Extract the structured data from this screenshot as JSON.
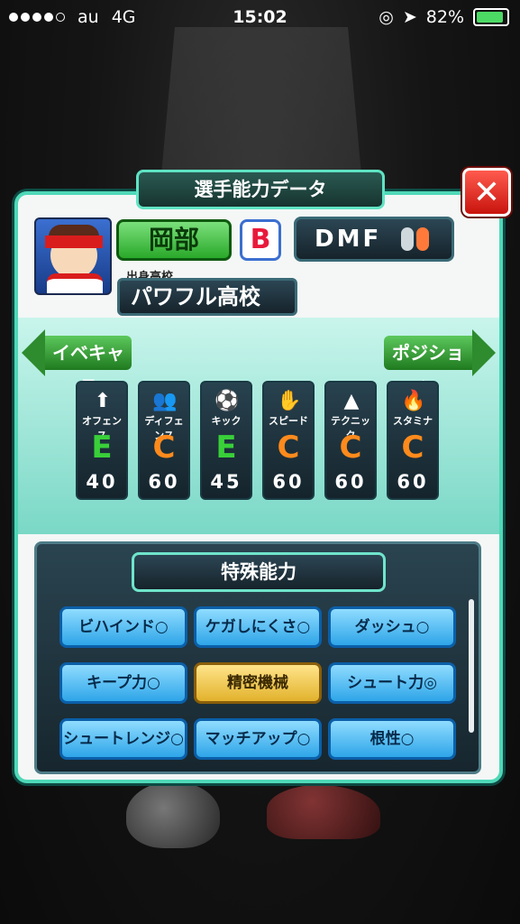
{
  "status_bar": {
    "carrier": "au",
    "network": "4G",
    "time": "15:02",
    "battery": "82%",
    "battery_color": "#4cd964"
  },
  "panel": {
    "title": "選手能力データ",
    "close_icon": "close-icon",
    "close_glyph": "✕",
    "accent": "#4fd8b8"
  },
  "player": {
    "name": "岡部",
    "rank": "B",
    "rank_color": "#e81a3c",
    "position": "DMF",
    "school_label": "出身高校",
    "school": "パワフル高校"
  },
  "nav": {
    "left_label": "イベキャラ",
    "right_label": "ポジション"
  },
  "stats": [
    {
      "label": "オフェンス",
      "grade": "E",
      "value": "40",
      "grade_color": "#39d039",
      "icon": "goal-icon",
      "glyph": "⬆"
    },
    {
      "label": "ディフェンス",
      "grade": "C",
      "value": "60",
      "grade_color": "#ff8a1c",
      "icon": "defenders-icon",
      "glyph": "👥"
    },
    {
      "label": "キック",
      "grade": "E",
      "value": "45",
      "grade_color": "#39d039",
      "icon": "kick-icon",
      "glyph": "⚽"
    },
    {
      "label": "スピード",
      "grade": "C",
      "value": "60",
      "grade_color": "#ff8a1c",
      "icon": "speed-icon",
      "glyph": "✋"
    },
    {
      "label": "テクニック",
      "grade": "C",
      "value": "60",
      "grade_color": "#ff8a1c",
      "icon": "technique-icon",
      "glyph": "▲"
    },
    {
      "label": "スタミナ",
      "grade": "C",
      "value": "60",
      "grade_color": "#ff8a1c",
      "icon": "stamina-icon",
      "glyph": "🔥"
    }
  ],
  "abilities": {
    "title": "特殊能力",
    "items": [
      {
        "label": "ビハインド○",
        "style": "blue"
      },
      {
        "label": "ケガしにくさ○",
        "style": "blue"
      },
      {
        "label": "ダッシュ○",
        "style": "blue"
      },
      {
        "label": "キープ力○",
        "style": "blue"
      },
      {
        "label": "精密機械",
        "style": "gold"
      },
      {
        "label": "シュート力◎",
        "style": "blue"
      },
      {
        "label": "シュートレンジ○",
        "style": "blue"
      },
      {
        "label": "マッチアップ○",
        "style": "blue"
      },
      {
        "label": "根性○",
        "style": "blue"
      }
    ]
  }
}
